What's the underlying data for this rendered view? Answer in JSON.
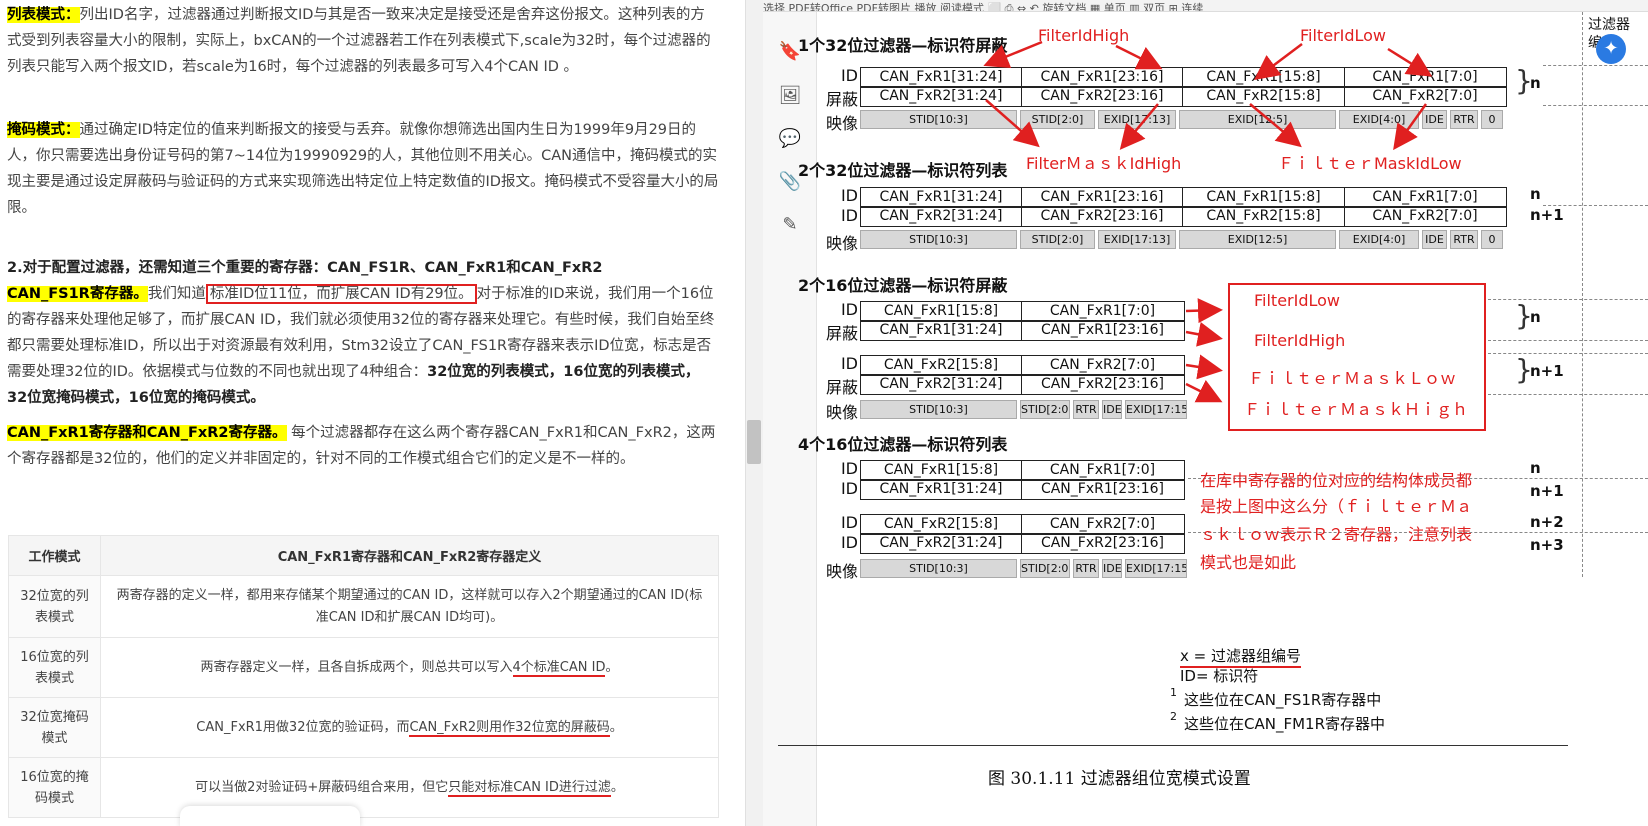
{
  "article": {
    "p1": {
      "label": "列表模式：",
      "text": "列出ID名字，过滤器通过判断报文ID与其是否一致来决定是接受还是舍弃这份报文。这种列表的方式受到列表容量大小的限制，实际上，bxCAN的一个过滤器若工作在列表模式下,scale为32时，每个过滤器的列表只能写入两个报文ID，若scale为16时，每个过滤器的列表最多可写入4个CAN ID 。"
    },
    "p2": {
      "label": "掩码模式：",
      "text": "通过确定ID特定位的值来判断报文的接受与丢弃。就像你想筛选出国内生日为1999年9月29日的人，你只需要选出身份证号码的第7~14位为19990929的人，其他位则不用关心。CAN通信中，掩码模式的实现主要是通过设定屏蔽码与验证码的方式来实现筛选出特定位上特定数值的ID报文。掩码模式不受容量大小的局限。"
    },
    "p3": {
      "heading": "2.对于配置过滤器，还需知道三个重要的寄存器：CAN_FS1R、CAN_FxR1和CAN_FxR2",
      "label": "CAN_FS1R寄存器。",
      "t1": "我们知道",
      "boxed": "标准ID位11位，而扩展CAN ID有29位。",
      "t2": "对于标准的ID来说，我们用一个16位的寄存器来处理他足够了，而扩展CAN ID，我们就必须使用32位的寄存器来处理它。有些时候，我们自始至终都只需要处理标准ID，所以出于对资源最有效利用，Stm32设立了CAN_FS1R寄存器来表示ID位宽，标志是否需要处理32位的ID。依据模式与位数的不同也就出现了4种组合：",
      "bold": "32位宽的列表模式，16位宽的列表模式，32位宽掩码模式，16位宽的掩码模式。"
    },
    "p4": {
      "label": "CAN_FxR1寄存器和CAN_FxR2寄存器。",
      "text": " 每个过滤器都存在这么两个寄存器CAN_FxR1和CAN_FxR2，这两个寄存器都是32位的，他们的定义并非固定的，针对不同的工作模式组合它们的定义是不一样的。"
    },
    "table": {
      "headers": [
        "工作模式",
        "CAN_FxR1寄存器和CAN_FxR2寄存器定义"
      ],
      "rows": [
        {
          "mode": "32位宽的列表模式",
          "def": "两寄存器的定义一样，都用来存储某个期望通过的CAN ID，这样就可以存入2个期望通过的CAN ID(标准CAN ID和扩展CAN ID均可)。"
        },
        {
          "mode": "16位宽的列表模式",
          "pre": "两寄存器定义一样，且各自拆成两个，则总共可以写入",
          "ul": "4个标准CAN ID",
          "post": "。"
        },
        {
          "mode": "32位宽掩码模式",
          "pre": "CAN_FxR1用做32位宽的验证码，而",
          "ul": "CAN_FxR2则用作32位宽的屏蔽码",
          "post": "。"
        },
        {
          "mode": "16位宽的掩码模式",
          "pre": "可以当做2对验证码+屏蔽码组合来用，但它",
          "ul": "只能对标准CAN ID进行过滤",
          "post": "。"
        }
      ]
    }
  },
  "toolbar": {
    "text": "  选择      PDF转Office      PDF转图片      播放    阅读模式      ⬜  ⎙  ⇔      ↶      旋转文档      ▦ 单页  ▥ 双页    ⊞ 连续"
  },
  "tools": {
    "bookmark": "🔖",
    "image": "🖼",
    "comment": "💬",
    "attach": "📎",
    "sign": "✎"
  },
  "pdf": {
    "s1": "1个32位过滤器—标识符屏蔽",
    "s2": "2个32位过滤器—标识符列表",
    "s3": "2个16位过滤器—标识符屏蔽",
    "s4": "4个16位过滤器—标识符列表",
    "lab_id": "ID",
    "lab_mask": "屏蔽",
    "lab_map": "映像",
    "r32a": [
      "CAN_FxR1[31:24]",
      "CAN_FxR1[23:16]",
      "CAN_FxR1[15:8]",
      "CAN_FxR1[7:0]"
    ],
    "r32b": [
      "CAN_FxR2[31:24]",
      "CAN_FxR2[23:16]",
      "CAN_FxR2[15:8]",
      "CAN_FxR2[7:0]"
    ],
    "map32": [
      "STID[10:3]",
      "STID[2:0]",
      "EXID[17:13]",
      "EXID[12:5]",
      "EXID[4:0]",
      "IDE",
      "RTR",
      "0"
    ],
    "r16a1": [
      "CAN_FxR1[15:8]",
      "CAN_FxR1[7:0]"
    ],
    "r16a2": [
      "CAN_FxR1[31:24]",
      "CAN_FxR1[23:16]"
    ],
    "r16b1": [
      "CAN_FxR2[15:8]",
      "CAN_FxR2[7:0]"
    ],
    "r16b2": [
      "CAN_FxR2[31:24]",
      "CAN_FxR2[23:16]"
    ],
    "map16": [
      "STID[10:3]",
      "STID[2:0]",
      "RTR",
      "IDE",
      "EXID[17:15]"
    ],
    "n": "n",
    "n1": "n+1",
    "n2": "n+2",
    "n3": "n+3",
    "corner": "过滤器\n编",
    "legend1": "x = 过滤器组编号",
    "legend2": "ID= 标识符",
    "legend3": "这些位在CAN_FS1R寄存器中",
    "legend4": "这些位在CAN_FM1R寄存器中",
    "sup1": "1",
    "sup2": "2",
    "caption": "图 30.1.11 过滤器组位宽模式设置"
  },
  "notes": {
    "idHigh": "FilterIdHigh",
    "idLow": "FilterIdLow",
    "maskHigh": "FilterＭａｓｋIdHigh",
    "maskLow": "ＦｉｌｔｅｒMaskIdLow",
    "b1": "FilterIdLow",
    "b2": "FilterIdHigh",
    "b3": "ＦｉｌｔｅｒＭａｓｋＬｏｗ",
    "b4": "ＦｉｌｔｅｒＭａｓｋＨｉｇｈ",
    "note1": "在库中寄存器的位对应的结构体成员都",
    "note2": "是按上图中这么分（ｆｉｌｔｅｒＭａ",
    "note3": "ｓｋｌｏｗ表示Ｒ２寄存器，注意列表",
    "note4": "模式也是如此"
  }
}
